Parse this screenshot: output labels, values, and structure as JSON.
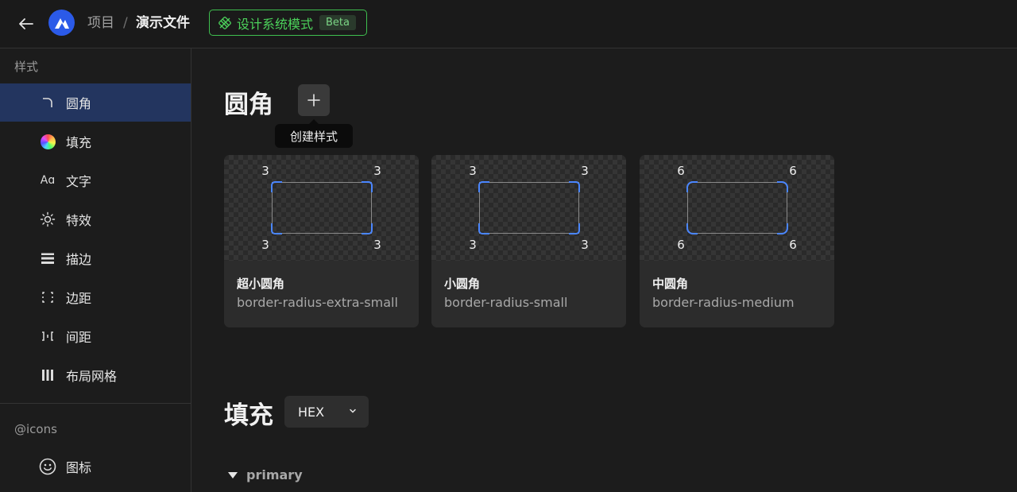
{
  "header": {
    "project": "项目",
    "separator": "/",
    "file": "演示文件",
    "mode_label": "设计系统模式",
    "beta": "Beta"
  },
  "sidebar": {
    "styles_heading": "样式",
    "items": [
      {
        "label": "圆角",
        "icon": "corner-radius-icon"
      },
      {
        "label": "填充",
        "icon": "color-wheel-icon"
      },
      {
        "label": "文字",
        "icon": "text-aa-icon"
      },
      {
        "label": "特效",
        "icon": "sun-effect-icon"
      },
      {
        "label": "描边",
        "icon": "stroke-lines-icon"
      },
      {
        "label": "边距",
        "icon": "padding-icon"
      },
      {
        "label": "间距",
        "icon": "gap-icon"
      },
      {
        "label": "布局网格",
        "icon": "layout-grid-icon"
      }
    ],
    "icons_heading": "@icons",
    "icon_item": {
      "label": "图标",
      "icon": "smiley-icon"
    }
  },
  "main": {
    "radius_title": "圆角",
    "tooltip": "创建样式",
    "cards": [
      {
        "name": "超小圆角",
        "token": "border-radius-extra-small",
        "tl": "3",
        "tr": "3",
        "bl": "3",
        "br": "3"
      },
      {
        "name": "小圆角",
        "token": "border-radius-small",
        "tl": "3",
        "tr": "3",
        "bl": "3",
        "br": "3"
      },
      {
        "name": "中圆角",
        "token": "border-radius-medium",
        "tl": "6",
        "tr": "6",
        "bl": "6",
        "br": "6"
      }
    ],
    "fill_title": "填充",
    "format_select": "HEX",
    "group_name": "primary"
  },
  "colors": {
    "accent_blue": "#2b5ae8",
    "active_bg": "#23355f",
    "ds_green": "#4cd35b",
    "corner_blue": "#4a86ff"
  }
}
